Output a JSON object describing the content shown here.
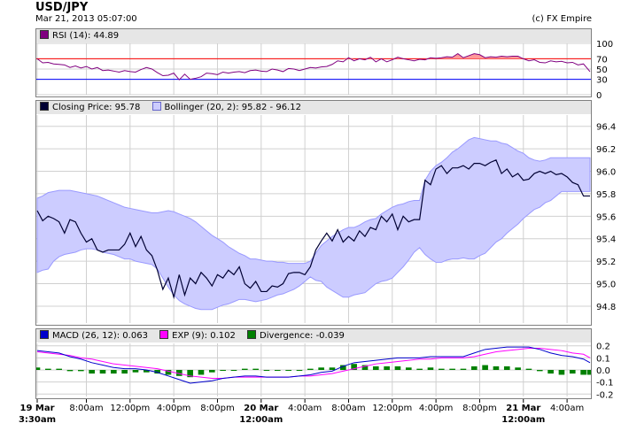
{
  "header": {
    "title": "USD/JPY",
    "timestamp": "Mar 21, 2013 05:07:00",
    "copyright": "(c) FX Empire"
  },
  "legends": {
    "rsi": "RSI (14): 44.89",
    "closing": "Closing Price: 95.78",
    "bollinger": "Bollinger (20, 2): 95.82 - 96.12",
    "macd": "MACD (26, 12): 0.063",
    "exp": "EXP (9): 0.102",
    "divergence": "Divergence: -0.039"
  },
  "colors": {
    "rsi_line": "#800080",
    "rsi_overbought": "#ff0000",
    "rsi_oversold": "#0000ff",
    "price_line": "#000033",
    "bollinger_fill": "#ccccff",
    "bollinger_edge": "#9999ff",
    "macd_line": "#0000cc",
    "exp_line": "#ff00ff",
    "divergence_bar": "#008000",
    "grid": "#d0d0d0"
  },
  "x_axis": {
    "ticks": [
      {
        "t": 0,
        "line1": "19 Mar",
        "line2": "3:30am",
        "bold": true
      },
      {
        "t": 4.5,
        "line1": "8:00am",
        "line2": "",
        "bold": false
      },
      {
        "t": 8.5,
        "line1": "12:00pm",
        "line2": "",
        "bold": false
      },
      {
        "t": 12.5,
        "line1": "4:00pm",
        "line2": "",
        "bold": false
      },
      {
        "t": 16.5,
        "line1": "8:00pm",
        "line2": "",
        "bold": false
      },
      {
        "t": 20.5,
        "line1": "20 Mar",
        "line2": "12:00am",
        "bold": true
      },
      {
        "t": 24.5,
        "line1": "4:00am",
        "line2": "",
        "bold": false
      },
      {
        "t": 28.5,
        "line1": "8:00am",
        "line2": "",
        "bold": false
      },
      {
        "t": 32.5,
        "line1": "12:00pm",
        "line2": "",
        "bold": false
      },
      {
        "t": 36.5,
        "line1": "4:00pm",
        "line2": "",
        "bold": false
      },
      {
        "t": 40.5,
        "line1": "8:00pm",
        "line2": "",
        "bold": false
      },
      {
        "t": 44.5,
        "line1": "21 Mar",
        "line2": "12:00am",
        "bold": true
      },
      {
        "t": 48.5,
        "line1": "4:00am",
        "line2": "",
        "bold": false
      }
    ],
    "end": 50.6
  },
  "chart_data": [
    {
      "type": "line",
      "name_text": "RSI (14)",
      "ylim": [
        0,
        100
      ],
      "y_ticks": [
        0,
        30,
        50,
        70,
        100
      ],
      "levels": [
        30,
        70
      ],
      "x": [
        0,
        0.5,
        1,
        1.5,
        2,
        2.5,
        3,
        3.5,
        4,
        4.5,
        5,
        5.5,
        6,
        6.5,
        7,
        7.5,
        8,
        8.5,
        9,
        9.5,
        10,
        10.5,
        11,
        11.5,
        12,
        12.5,
        13,
        13.5,
        14,
        14.5,
        15,
        15.5,
        16,
        16.5,
        17,
        17.5,
        18,
        18.5,
        19,
        19.5,
        20,
        20.5,
        21,
        21.5,
        22,
        22.5,
        23,
        23.5,
        24,
        24.5,
        25,
        25.5,
        26,
        26.5,
        27,
        27.5,
        28,
        28.5,
        29,
        29.5,
        30,
        30.5,
        31,
        31.5,
        32,
        32.5,
        33,
        33.5,
        34,
        34.5,
        35,
        35.5,
        36,
        36.5,
        37,
        37.5,
        38,
        38.5,
        39,
        39.5,
        40,
        40.5,
        41,
        41.5,
        42,
        42.5,
        43,
        43.5,
        44,
        44.5,
        45,
        45.5,
        46,
        46.5,
        47,
        47.5,
        48,
        48.5,
        49,
        49.5,
        50,
        50.6
      ],
      "values": [
        70,
        62,
        63,
        60,
        59,
        58,
        53,
        56,
        52,
        55,
        50,
        53,
        47,
        48,
        46,
        44,
        47,
        45,
        44,
        49,
        53,
        50,
        43,
        37,
        38,
        42,
        29,
        40,
        30,
        32,
        35,
        42,
        41,
        39,
        44,
        42,
        44,
        45,
        43,
        47,
        48,
        46,
        45,
        50,
        48,
        45,
        51,
        50,
        47,
        50,
        53,
        52,
        54,
        55,
        59,
        66,
        64,
        72,
        66,
        70,
        68,
        73,
        64,
        70,
        64,
        68,
        73,
        70,
        68,
        66,
        69,
        68,
        72,
        71,
        72,
        74,
        73,
        80,
        72,
        76,
        80,
        78,
        72,
        74,
        73,
        75,
        74,
        75,
        75,
        70,
        66,
        68,
        63,
        62,
        66,
        64,
        65,
        62,
        63,
        58,
        60,
        45
      ]
    },
    {
      "type": "line",
      "name_text": "Closing Price",
      "ylim": [
        94.65,
        96.5
      ],
      "y_ticks": [
        94.8,
        95.0,
        95.2,
        95.4,
        95.6,
        95.8,
        96.0,
        96.2,
        96.4
      ],
      "x": [
        0,
        0.5,
        1,
        1.5,
        2,
        2.5,
        3,
        3.5,
        4,
        4.5,
        5,
        5.5,
        6,
        6.5,
        7,
        7.5,
        8,
        8.5,
        9,
        9.5,
        10,
        10.5,
        11,
        11.5,
        12,
        12.5,
        13,
        13.5,
        14,
        14.5,
        15,
        15.5,
        16,
        16.5,
        17,
        17.5,
        18,
        18.5,
        19,
        19.5,
        20,
        20.5,
        21,
        21.5,
        22,
        22.5,
        23,
        23.5,
        24,
        24.5,
        25,
        25.5,
        26,
        26.5,
        27,
        27.5,
        28,
        28.5,
        29,
        29.5,
        30,
        30.5,
        31,
        31.5,
        32,
        32.5,
        33,
        33.5,
        34,
        34.5,
        35,
        35.5,
        36,
        36.5,
        37,
        37.5,
        38,
        38.5,
        39,
        39.5,
        40,
        40.5,
        41,
        41.5,
        42,
        42.5,
        43,
        43.5,
        44,
        44.5,
        45,
        45.5,
        46,
        46.5,
        47,
        47.5,
        48,
        48.5,
        49,
        49.5,
        50,
        50.6
      ],
      "values": [
        95.65,
        95.56,
        95.6,
        95.58,
        95.55,
        95.45,
        95.57,
        95.55,
        95.45,
        95.37,
        95.4,
        95.3,
        95.28,
        95.3,
        95.3,
        95.3,
        95.35,
        95.45,
        95.33,
        95.42,
        95.3,
        95.25,
        95.12,
        94.95,
        95.05,
        94.88,
        95.08,
        94.9,
        95.05,
        95.0,
        95.1,
        95.05,
        94.98,
        95.08,
        95.05,
        95.12,
        95.08,
        95.15,
        95.0,
        94.96,
        95.02,
        94.93,
        94.93,
        94.98,
        94.97,
        95.0,
        95.09,
        95.1,
        95.1,
        95.08,
        95.15,
        95.3,
        95.38,
        95.45,
        95.38,
        95.48,
        95.37,
        95.42,
        95.38,
        95.47,
        95.42,
        95.5,
        95.48,
        95.6,
        95.55,
        95.62,
        95.48,
        95.6,
        95.55,
        95.57,
        95.57,
        95.92,
        95.88,
        96.02,
        96.05,
        95.98,
        96.03,
        96.03,
        96.05,
        96.02,
        96.07,
        96.07,
        96.05,
        96.08,
        96.1,
        95.98,
        96.02,
        95.95,
        95.98,
        95.92,
        95.93,
        95.98,
        96.0,
        95.98,
        96.0,
        95.97,
        95.98,
        95.95,
        95.9,
        95.88,
        95.78,
        95.78
      ],
      "band_upper": [
        95.76,
        95.78,
        95.81,
        95.82,
        95.83,
        95.83,
        95.83,
        95.82,
        95.81,
        95.8,
        95.79,
        95.78,
        95.76,
        95.74,
        95.72,
        95.7,
        95.68,
        95.67,
        95.66,
        95.65,
        95.64,
        95.63,
        95.63,
        95.64,
        95.65,
        95.64,
        95.62,
        95.6,
        95.58,
        95.55,
        95.51,
        95.47,
        95.43,
        95.4,
        95.37,
        95.33,
        95.3,
        95.27,
        95.25,
        95.22,
        95.22,
        95.21,
        95.2,
        95.2,
        95.19,
        95.19,
        95.18,
        95.18,
        95.18,
        95.18,
        95.2,
        95.27,
        95.34,
        95.38,
        95.42,
        95.45,
        95.48,
        95.5,
        95.5,
        95.52,
        95.55,
        95.57,
        95.58,
        95.62,
        95.65,
        95.68,
        95.7,
        95.71,
        95.73,
        95.74,
        95.74,
        95.92,
        96.0,
        96.05,
        96.08,
        96.12,
        96.17,
        96.2,
        96.24,
        96.28,
        96.3,
        96.29,
        96.28,
        96.27,
        96.27,
        96.25,
        96.24,
        96.21,
        96.18,
        96.16,
        96.12,
        96.1,
        96.09,
        96.1,
        96.12,
        96.12,
        96.12,
        96.12,
        96.12,
        96.12,
        96.12,
        96.12
      ],
      "band_lower": [
        95.1,
        95.12,
        95.13,
        95.2,
        95.24,
        95.26,
        95.27,
        95.28,
        95.3,
        95.31,
        95.31,
        95.3,
        95.28,
        95.27,
        95.26,
        95.24,
        95.22,
        95.22,
        95.2,
        95.19,
        95.18,
        95.17,
        95.13,
        95.05,
        94.97,
        94.9,
        94.85,
        94.82,
        94.8,
        94.78,
        94.77,
        94.77,
        94.77,
        94.79,
        94.81,
        94.82,
        94.84,
        94.86,
        94.86,
        94.85,
        94.84,
        94.85,
        94.86,
        94.88,
        94.9,
        94.91,
        94.93,
        94.95,
        94.98,
        95.02,
        95.06,
        95.03,
        95.02,
        94.97,
        94.94,
        94.91,
        94.88,
        94.88,
        94.9,
        94.91,
        94.92,
        94.96,
        95.0,
        95.02,
        95.03,
        95.05,
        95.1,
        95.15,
        95.21,
        95.28,
        95.32,
        95.26,
        95.22,
        95.19,
        95.19,
        95.21,
        95.22,
        95.22,
        95.23,
        95.22,
        95.22,
        95.25,
        95.27,
        95.32,
        95.37,
        95.4,
        95.45,
        95.49,
        95.53,
        95.58,
        95.62,
        95.66,
        95.68,
        95.72,
        95.74,
        95.78,
        95.82,
        95.82,
        95.82,
        95.82,
        95.82,
        95.82
      ]
    },
    {
      "type": "line",
      "name_text": "MACD",
      "ylim": [
        -0.22,
        0.22
      ],
      "y_ticks": [
        -0.2,
        -0.1,
        0.0,
        0.1,
        0.2
      ],
      "x": [
        0,
        1,
        2,
        3,
        4,
        5,
        6,
        7,
        8,
        9,
        10,
        11,
        12,
        13,
        14,
        15,
        16,
        17,
        18,
        19,
        20,
        21,
        22,
        23,
        24,
        25,
        26,
        27,
        28,
        29,
        30,
        31,
        32,
        33,
        34,
        35,
        36,
        37,
        38,
        39,
        40,
        41,
        42,
        43,
        44,
        45,
        46,
        47,
        48,
        49,
        50,
        50.6
      ],
      "values": [
        0.16,
        0.15,
        0.14,
        0.11,
        0.09,
        0.06,
        0.04,
        0.02,
        0.01,
        0.01,
        0.0,
        -0.02,
        -0.05,
        -0.08,
        -0.11,
        -0.1,
        -0.09,
        -0.07,
        -0.06,
        -0.05,
        -0.05,
        -0.06,
        -0.06,
        -0.06,
        -0.05,
        -0.04,
        -0.02,
        -0.01,
        0.03,
        0.06,
        0.07,
        0.08,
        0.09,
        0.1,
        0.1,
        0.1,
        0.11,
        0.11,
        0.11,
        0.11,
        0.14,
        0.17,
        0.18,
        0.19,
        0.19,
        0.19,
        0.17,
        0.14,
        0.12,
        0.11,
        0.09,
        0.06
      ],
      "exp": [
        0.15,
        0.14,
        0.13,
        0.12,
        0.1,
        0.09,
        0.07,
        0.05,
        0.04,
        0.03,
        0.02,
        0.01,
        -0.01,
        -0.03,
        -0.05,
        -0.06,
        -0.07,
        -0.07,
        -0.06,
        -0.06,
        -0.06,
        -0.06,
        -0.06,
        -0.06,
        -0.05,
        -0.05,
        -0.04,
        -0.03,
        -0.01,
        0.01,
        0.03,
        0.05,
        0.06,
        0.07,
        0.08,
        0.09,
        0.09,
        0.1,
        0.1,
        0.1,
        0.11,
        0.13,
        0.15,
        0.16,
        0.17,
        0.18,
        0.18,
        0.17,
        0.16,
        0.14,
        0.13,
        0.1
      ],
      "divergence": [
        0.02,
        0.01,
        0.01,
        -0.01,
        -0.01,
        -0.03,
        -0.03,
        -0.03,
        -0.03,
        -0.02,
        -0.02,
        -0.03,
        -0.04,
        -0.05,
        -0.06,
        -0.04,
        -0.02,
        0.0,
        0.0,
        0.01,
        0.01,
        0.0,
        0.0,
        0.0,
        0.0,
        0.01,
        0.02,
        0.02,
        0.04,
        0.05,
        0.04,
        0.03,
        0.03,
        0.03,
        0.02,
        0.01,
        0.02,
        0.01,
        0.01,
        0.01,
        0.03,
        0.04,
        0.03,
        0.03,
        0.02,
        0.01,
        -0.01,
        -0.03,
        -0.04,
        -0.03,
        -0.04,
        -0.04
      ]
    }
  ]
}
